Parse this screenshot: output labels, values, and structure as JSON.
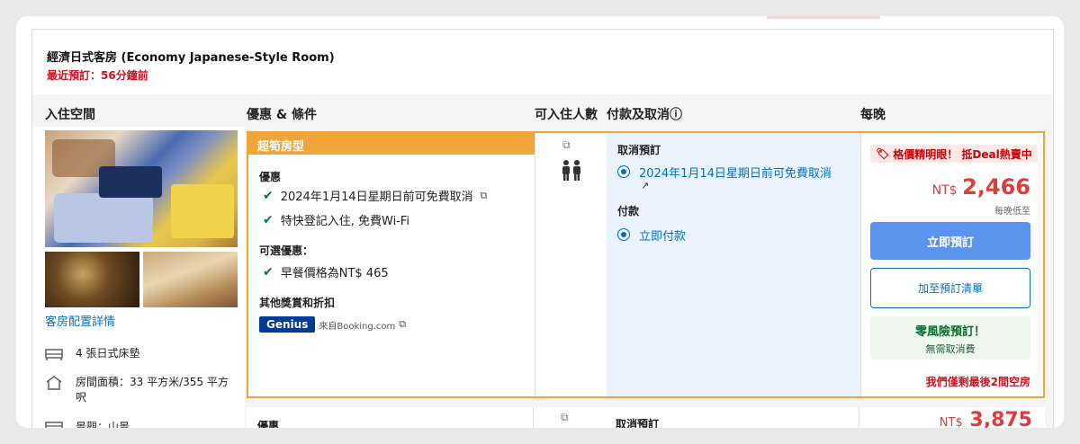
{
  "room": {
    "title": "經濟日式客房 (Economy Japanese-Style Room)",
    "recent_booking": "最近預訂：56分鐘前"
  },
  "columns": {
    "space": "入住空間",
    "offers": "優惠 & 條件",
    "occupancy": "可入住人數",
    "payment": "付款及取消ⓘ",
    "per_night": "每晚"
  },
  "left": {
    "room_details_link": "客房配置詳情",
    "features": [
      {
        "icon": "bed-icon",
        "text": "4 張日式床墊"
      },
      {
        "icon": "house-icon",
        "text": "房間面積：33 平方米/355 平方呎"
      },
      {
        "icon": "window-icon",
        "text": "景觀：山景"
      }
    ]
  },
  "offer": {
    "badge": "超筍房型",
    "benefits_heading": "優惠",
    "benefits": [
      "2024年1月14日星期日前可免費取消",
      "特快登記入住, 免費Wi-Fi"
    ],
    "optional_heading": "可選優惠：",
    "optional": [
      "早餐價格為NT$ 465"
    ],
    "rewards_heading": "其他獎賞和折扣",
    "genius_label": "Genius",
    "genius_from": "來自Booking.com",
    "cancel_heading": "取消預訂",
    "cancel_option": "2024年1月14日星期日前可免費取消",
    "pay_heading": "付款",
    "pay_option": "立即付款",
    "deal_tag": "格價精明眼！ 抵Deal熱賣中",
    "price_currency": "NT$",
    "price_amount": "2,466",
    "price_note": "每晚低至",
    "reserve_button": "立即預訂",
    "add_button": "加至預訂清單",
    "no_risk_title": "零風險預訂！",
    "no_risk_sub": "無需取消費",
    "last_rooms": "我們僅剩最後2間空房"
  },
  "next_offer": {
    "benefits_heading": "優惠",
    "cancel_heading": "取消預訂",
    "price_currency": "NT$",
    "price_amount": "3,875"
  }
}
